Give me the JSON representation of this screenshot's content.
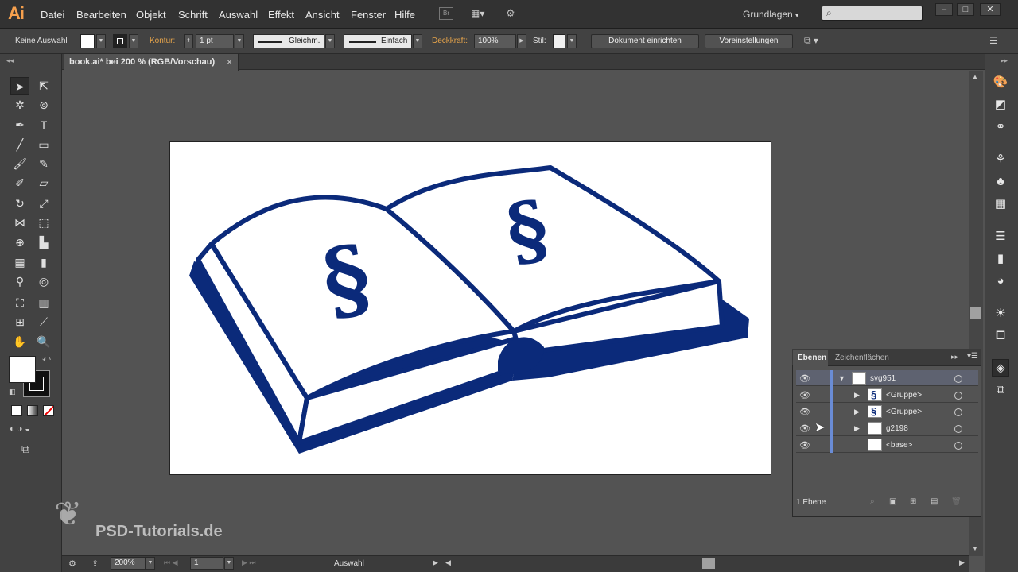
{
  "app": {
    "logo": "Ai"
  },
  "menu": [
    "Datei",
    "Bearbeiten",
    "Objekt",
    "Schrift",
    "Auswahl",
    "Effekt",
    "Ansicht",
    "Fenster",
    "Hilfe"
  ],
  "bridge_label": "Br",
  "workspace": "Grundlagen",
  "window_buttons": [
    "–",
    "□",
    "✕"
  ],
  "control": {
    "selection": "Keine Auswahl",
    "stroke_label": "Kontur:",
    "stroke_weight": "1 pt",
    "profile": "Gleichm.",
    "brush": "Einfach",
    "opacity_label": "Deckkraft:",
    "opacity": "100%",
    "style_label": "Stil:",
    "doc_setup": "Dokument einrichten",
    "preferences": "Voreinstellungen"
  },
  "document": {
    "tab": "book.ai* bei 200 % (RGB/Vorschau)",
    "close": "×"
  },
  "layers_panel": {
    "tabs": [
      "Ebenen",
      "Zeichenflächen"
    ],
    "rows": [
      {
        "name": "svg951",
        "expanded": true
      },
      {
        "name": "<Gruppe>",
        "expanded": false
      },
      {
        "name": "<Gruppe>",
        "expanded": false
      },
      {
        "name": "g2198",
        "expanded": false
      },
      {
        "name": "<base>",
        "expanded": false
      }
    ],
    "footer": "1 Ebene"
  },
  "status": {
    "zoom": "200%",
    "page": "1",
    "mode": "Auswahl"
  },
  "watermark": "PSD-Tutorials.de",
  "colors": {
    "book": "#0b2a7a",
    "accent": "#f6a04d",
    "link": "#e8a54b"
  }
}
